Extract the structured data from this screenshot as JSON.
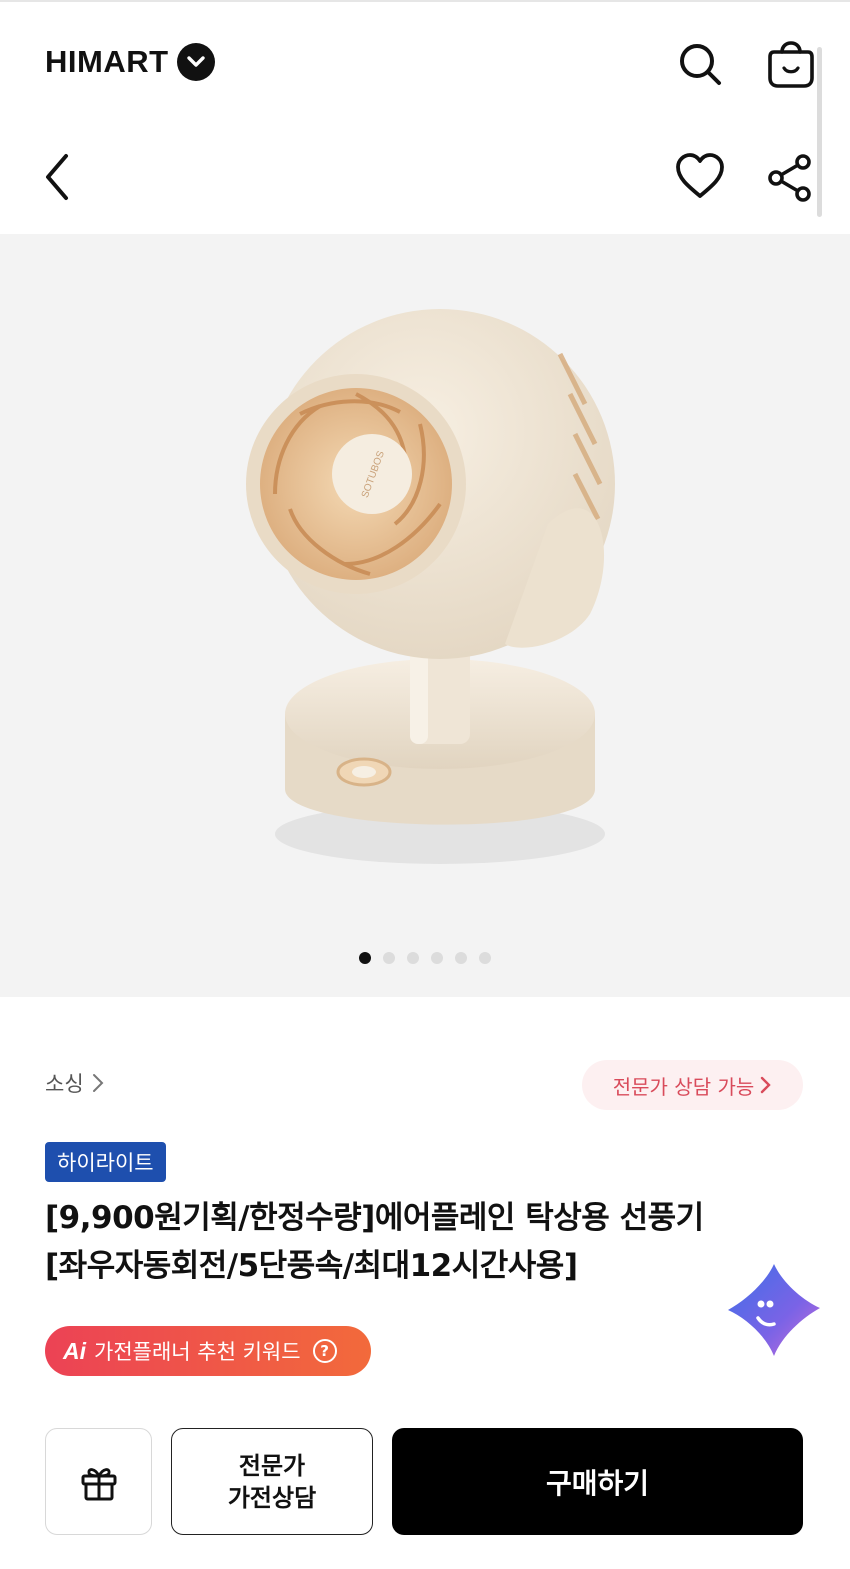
{
  "header": {
    "logo_text": "HIMART",
    "icons": [
      "search-icon",
      "shopping-bag-icon",
      "back-icon",
      "heart-icon",
      "share-icon"
    ]
  },
  "gallery": {
    "image_label": "SOTUBOS",
    "slide_count": 6,
    "active_slide": 1
  },
  "product": {
    "category": "소싱",
    "consult_label": "전문가 상담 가능",
    "badge": "하이라이트",
    "title_line1": "[9,900원기획/한정수량]에어플레인 탁상용 선풍기",
    "title_line2": "[좌우자동회전/5단풍속/최대12시간사용]",
    "ai_mark": "Ai",
    "ai_label": "가전플래너 추천 키워드",
    "ai_help": "?"
  },
  "actions": {
    "expert_line1": "전문가",
    "expert_line2": "가전상담",
    "buy_label": "구매하기"
  },
  "colors": {
    "brand_blue": "#1e4fae",
    "consult_pink": "#d94b5b",
    "ai_gradient_start": "#ec4255",
    "ai_gradient_end": "#f26a3b",
    "buy_black": "#000000"
  }
}
